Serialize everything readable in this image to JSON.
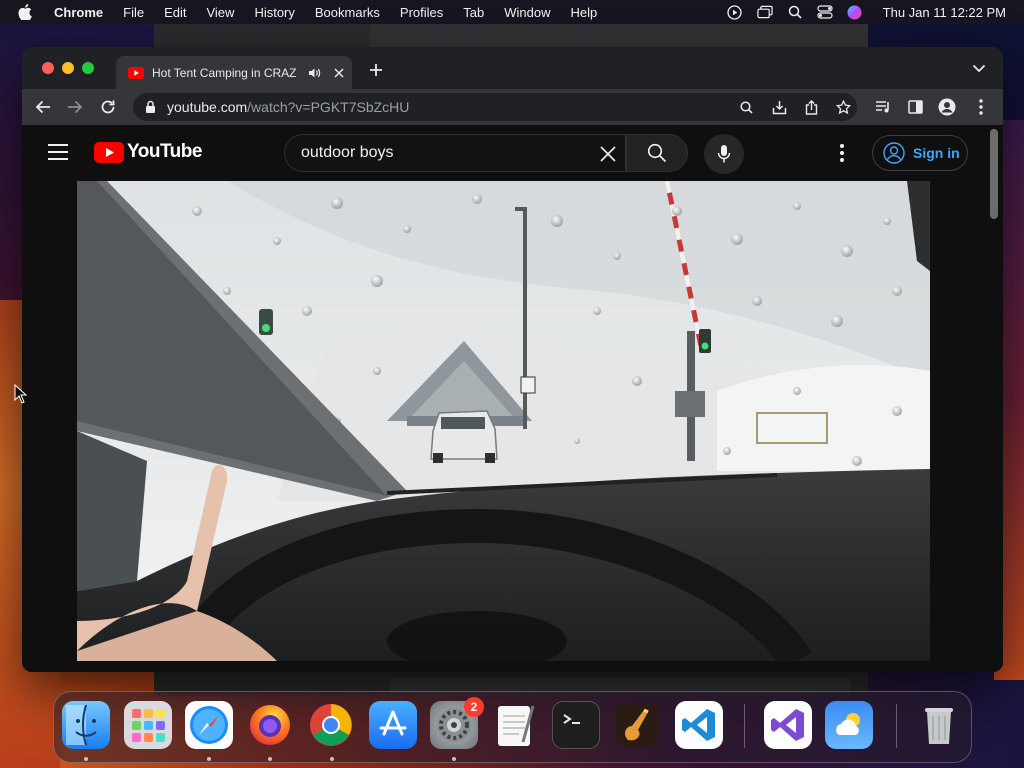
{
  "menubar": {
    "app_name": "Chrome",
    "items": [
      "File",
      "Edit",
      "View",
      "History",
      "Bookmarks",
      "Profiles",
      "Tab",
      "Window",
      "Help"
    ],
    "clock": "Thu Jan 11  12:22 PM",
    "status_icons": [
      "play-circle-icon",
      "window-stack-icon",
      "spotlight-search-icon",
      "control-center-icon",
      "siri-icon"
    ]
  },
  "browser": {
    "tab": {
      "title": "Hot Tent Camping in CRAZ",
      "favicon": "youtube-favicon-icon",
      "audio_icon": "speaker-icon"
    },
    "url_host": "youtube.com",
    "url_path": "/watch?v=PGKT7SbZcHU",
    "toolbar_icons": [
      "back-arrow-icon",
      "forward-arrow-icon",
      "reload-icon",
      "lock-icon",
      "zoom-search-icon",
      "install-icon",
      "share-icon",
      "bookmark-star-icon",
      "media-control-icon",
      "side-panel-icon",
      "profile-icon",
      "chrome-menu-icon"
    ]
  },
  "youtube": {
    "logo_text": "YouTube",
    "search_query": "outdoor boys",
    "sign_in_label": "Sign in",
    "colors": {
      "brand_red": "#ff0000",
      "link_blue": "#3ea6ff",
      "background": "#0f0f0f"
    }
  },
  "dock": {
    "apps": [
      {
        "name": "Finder",
        "icon": "finder-icon",
        "running": true
      },
      {
        "name": "Launchpad",
        "icon": "launchpad-icon",
        "running": false
      },
      {
        "name": "Safari",
        "icon": "safari-icon",
        "running": true
      },
      {
        "name": "Firefox",
        "icon": "firefox-icon",
        "running": true
      },
      {
        "name": "Chrome",
        "icon": "chrome-icon",
        "running": true
      },
      {
        "name": "App Store",
        "icon": "app-store-icon",
        "running": false
      },
      {
        "name": "System Settings",
        "icon": "system-settings-icon",
        "running": true,
        "badge": "2"
      },
      {
        "name": "TextEdit",
        "icon": "textedit-icon",
        "running": false
      },
      {
        "name": "Terminal",
        "icon": "terminal-icon",
        "running": false
      },
      {
        "name": "GarageBand",
        "icon": "garageband-icon",
        "running": false
      },
      {
        "name": "Visual Studio Code",
        "icon": "vscode-icon",
        "running": false
      },
      {
        "name": "Visual Studio",
        "icon": "visual-studio-icon",
        "running": false
      },
      {
        "name": "Weather",
        "icon": "weather-icon",
        "running": false
      },
      {
        "name": "Trash",
        "icon": "trash-icon",
        "running": false
      }
    ]
  }
}
